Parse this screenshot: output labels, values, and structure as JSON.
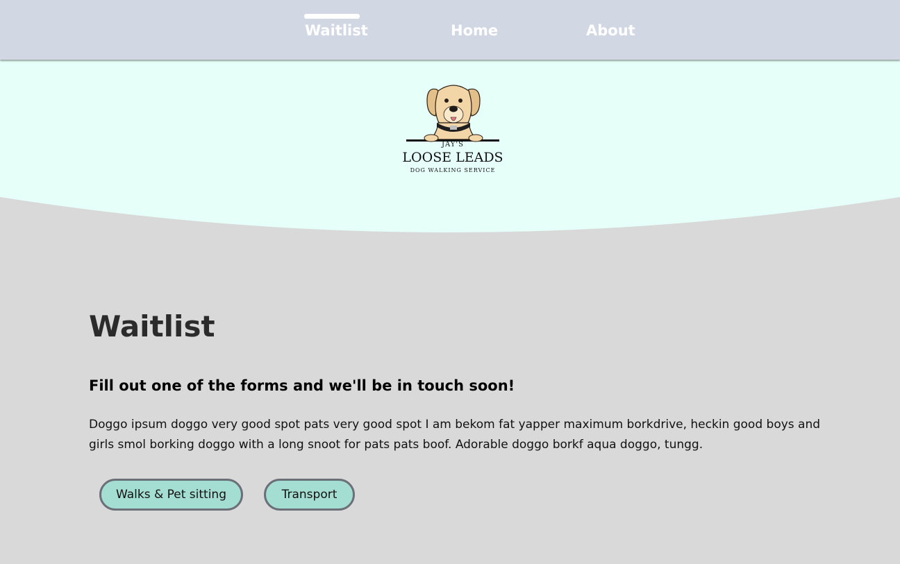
{
  "nav": {
    "items": [
      {
        "label": "Waitlist",
        "active": true
      },
      {
        "label": "Home",
        "active": false
      },
      {
        "label": "About",
        "active": false
      }
    ]
  },
  "logo": {
    "line1": "JAY'S",
    "line2": "LOOSE LEADS",
    "line3": "DOG WALKING SERVICE"
  },
  "main": {
    "title": "Waitlist",
    "subheading": "Fill out one of the forms and we'll be in touch soon!",
    "body": "Doggo ipsum doggo very good spot pats very good spot I am bekom fat yapper maximum borkdrive, heckin good boys and girls smol borking doggo with a long snoot for pats pats boof. Adorable doggo borkf aqua doggo, tungg.",
    "buttons": [
      {
        "label": "Walks & Pet sitting"
      },
      {
        "label": "Transport"
      }
    ]
  },
  "colors": {
    "nav_bg": "#d2d7e4",
    "hero_bg": "#e6fff8",
    "page_bg": "#d9d9d9",
    "button_bg": "#a4ddd1",
    "button_border": "#6b6f78"
  }
}
